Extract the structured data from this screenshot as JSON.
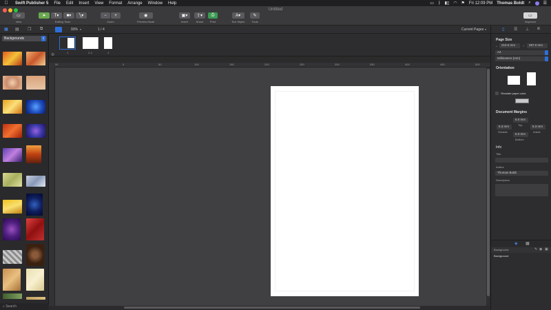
{
  "menubar": {
    "app_name": "Swift Publisher 5",
    "items": [
      "File",
      "Edit",
      "Insert",
      "View",
      "Format",
      "Arrange",
      "Window",
      "Help"
    ],
    "clock": "Fri 12:09 PM",
    "user": "Thomas Boldt"
  },
  "window": {
    "title": "Untitled"
  },
  "toolbar": {
    "view_label": "View",
    "editing_tools_label": "Editing Tools",
    "zoom_label": "Zoom",
    "preview_label": "Preview Mode",
    "insert_label": "Insert",
    "share_label": "Share",
    "print_label": "Print",
    "text_styles_label": "Text Styles",
    "tools_label": "Tools",
    "inspector_label": "Inspector"
  },
  "subbar": {
    "zoom_value": "93%",
    "page_counter": "1 / 4",
    "pages_dropdown": "Current Pages"
  },
  "leftpanel": {
    "category": "Backgrounds",
    "search_placeholder": "Search"
  },
  "pagestrip": {
    "pages": [
      "1",
      "2-3",
      "4"
    ]
  },
  "ruler": {
    "ticks": [
      "50",
      "",
      "0",
      "50",
      "100",
      "150",
      "200",
      "250",
      "300",
      "350",
      "400",
      "450",
      "500"
    ]
  },
  "inspector": {
    "page_size_title": "Page Size",
    "width": "210.0 mm",
    "height": "297.0 mm",
    "paper": "A4",
    "units": "Millimeters (mm)",
    "orientation_title": "Orientation",
    "simulate_paper": "Simulate paper color",
    "margins_title": "Document Margins",
    "margin_top": "6.0 mm",
    "margin_top_label": "Top",
    "margin_outside": "5.3 mm",
    "margin_outside_label": "Outside",
    "margin_inside": "5.3 mm",
    "margin_inside_label": "Inside",
    "margin_bottom": "6.0 mm",
    "margin_bottom_label": "Bottom",
    "info_title": "Info",
    "title_label": "Title",
    "author_label": "Author",
    "author_value": "Thomas Boldt",
    "description_label": "Description",
    "layers_header": "Background",
    "layer_item": "Background"
  },
  "colors": {
    "menubar_bg": "#1f1f21",
    "toolbar_bg": "#3a3a3c",
    "canvas_bg": "#404042",
    "accent": "#2d6fd8"
  }
}
